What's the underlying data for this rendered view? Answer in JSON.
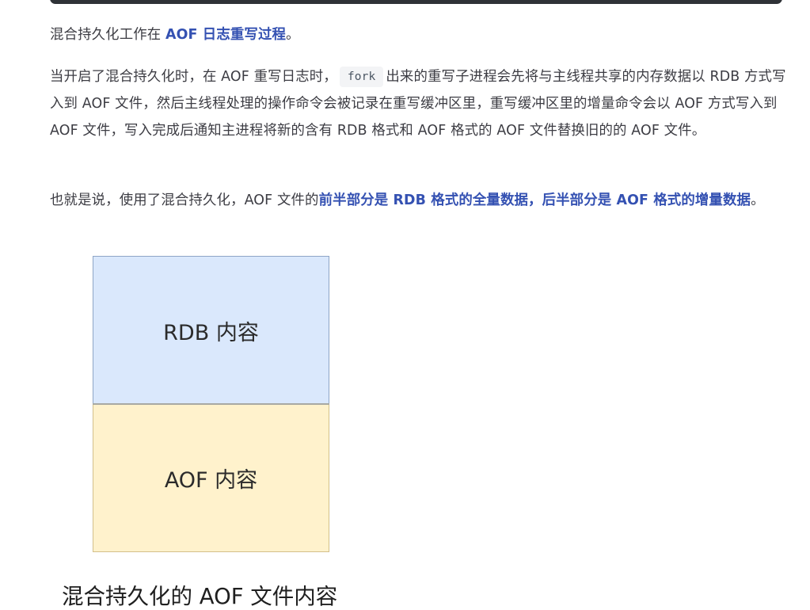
{
  "paragraph1": {
    "text1": "混合持久化工作在 ",
    "highlight": "AOF 日志重写过程",
    "text2": "。"
  },
  "paragraph2": {
    "text1": "当开启了混合持久化时，在 AOF 重写日志时，",
    "code": "fork",
    "text2": "出来的重写子进程会先将与主线程共享的内存数据以 RDB 方式写入到 AOF 文件，然后主线程处理的操作命令会被记录在重写缓冲区里，重写缓冲区里的增量命令会以 AOF 方式写入到 AOF 文件，写入完成后通知主进程将新的含有 RDB 格式和 AOF 格式的 AOF 文件替换旧的的 AOF 文件。"
  },
  "paragraph3": {
    "text1": "也就是说，使用了混合持久化，AOF 文件的",
    "highlight": "前半部分是 RDB 格式的全量数据，后半部分是 AOF 格式的增量数据",
    "text2": "。"
  },
  "figure": {
    "top_box_label": "RDB 内容",
    "bottom_box_label": "AOF 内容",
    "caption": "混合持久化的 AOF 文件内容",
    "top_box_color": "#dae8fc",
    "bottom_box_color": "#fff2cc"
  },
  "colors": {
    "highlight": "#3451b2",
    "text": "#3c3c43",
    "code_background": "#f3f4f6"
  }
}
